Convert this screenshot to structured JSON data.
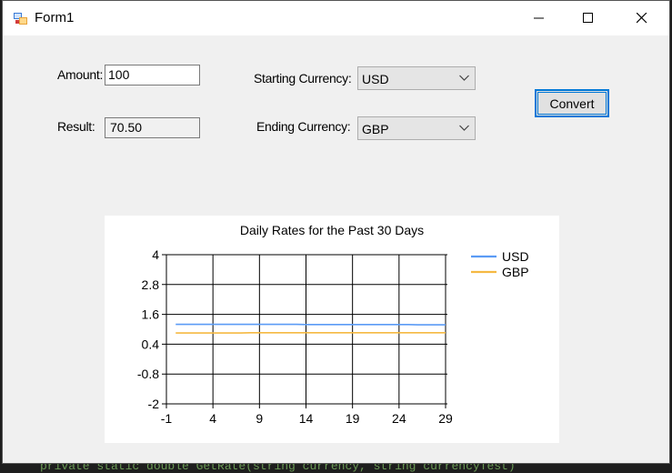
{
  "window": {
    "title": "Form1",
    "controls": {
      "minimize": "minimize-icon",
      "maximize": "maximize-icon",
      "close": "close-icon"
    }
  },
  "form": {
    "amount_label": "Amount:",
    "amount_value": "100",
    "result_label": "Result:",
    "result_value": "70.50",
    "starting_label": "Starting Currency:",
    "starting_value": "USD",
    "ending_label": "Ending Currency:",
    "ending_value": "GBP",
    "convert_label": "Convert"
  },
  "background_code": "private static double GetRate(string currency, string currencyTest)",
  "chart_data": {
    "type": "line",
    "title": "Daily Rates for the Past 30 Days",
    "xlabel": "",
    "ylabel": "",
    "x_ticks": [
      -1,
      4,
      9,
      14,
      19,
      24,
      29
    ],
    "y_ticks": [
      4,
      2.8,
      1.6,
      0.4,
      -0.8,
      -2
    ],
    "xlim": [
      -1,
      29
    ],
    "ylim": [
      -2,
      4
    ],
    "grid": true,
    "legend_position": "top-right",
    "x": [
      0,
      1,
      2,
      3,
      4,
      5,
      6,
      7,
      8,
      9,
      10,
      11,
      12,
      13,
      14,
      15,
      16,
      17,
      18,
      19,
      20,
      21,
      22,
      23,
      24,
      25,
      26,
      27,
      28,
      29
    ],
    "series": [
      {
        "name": "USD",
        "color": "#5b9bf5",
        "values": [
          1.2,
          1.2,
          1.2,
          1.2,
          1.2,
          1.2,
          1.2,
          1.2,
          1.2,
          1.2,
          1.2,
          1.2,
          1.2,
          1.2,
          1.19,
          1.19,
          1.19,
          1.19,
          1.19,
          1.19,
          1.19,
          1.19,
          1.19,
          1.19,
          1.19,
          1.19,
          1.18,
          1.18,
          1.18,
          1.18
        ]
      },
      {
        "name": "GBP",
        "color": "#f5b942",
        "values": [
          0.85,
          0.85,
          0.85,
          0.85,
          0.85,
          0.85,
          0.85,
          0.85,
          0.86,
          0.86,
          0.86,
          0.86,
          0.86,
          0.86,
          0.86,
          0.86,
          0.86,
          0.86,
          0.86,
          0.86,
          0.86,
          0.86,
          0.86,
          0.86,
          0.86,
          0.86,
          0.86,
          0.86,
          0.86,
          0.86
        ]
      }
    ]
  }
}
